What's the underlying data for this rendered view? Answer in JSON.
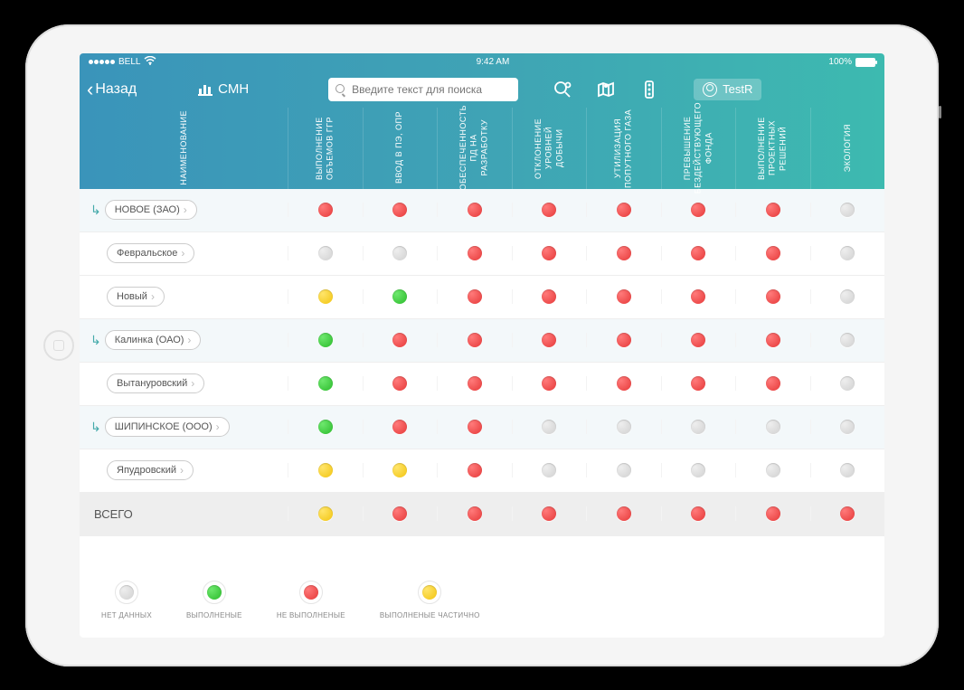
{
  "status_bar": {
    "carrier": "BELL",
    "time": "9:42 AM",
    "battery": "100%"
  },
  "nav": {
    "back_label": "Назад",
    "title": "СМН",
    "search_placeholder": "Введите текст для поиска",
    "user": "TestR"
  },
  "columns": {
    "name": "НАИМЕНОВАНИЕ",
    "c1": "ВЫПОЛНЕНИЕ ОБЪЕМОВ ГГР",
    "c2": "ВВОД В ПЭ, ОПР",
    "c3": "ОБЕСПЕЧЕННОСТЬ ПД НА РАЗРАБОТКУ",
    "c4": "ОТКЛОНЕНИЕ УРОВНЕЙ ДОБЫЧИ",
    "c5": "УТИЛИЗАЦИЯ ПОПУТНОГО ГАЗА",
    "c6": "ПРЕВЫШЕНИЕ БЕЗДЕЙСТВУЮЩЕГО ФОНДА",
    "c7": "ВЫПОЛНЕНИЕ ПРОЕКТНЫХ РЕШЕНИЙ",
    "c8": "ЭКОЛОГИЯ"
  },
  "rows": [
    {
      "type": "parent",
      "name": "НОВОЕ (ЗАО)",
      "status": [
        "red",
        "red",
        "red",
        "red",
        "red",
        "red",
        "red",
        "gray"
      ]
    },
    {
      "type": "child",
      "name": "Февральское",
      "status": [
        "gray",
        "gray",
        "red",
        "red",
        "red",
        "red",
        "red",
        "gray"
      ]
    },
    {
      "type": "child",
      "name": "Новый",
      "status": [
        "yellow",
        "green",
        "red",
        "red",
        "red",
        "red",
        "red",
        "gray"
      ]
    },
    {
      "type": "parent",
      "name": "Калинка (ОАО)",
      "status": [
        "green",
        "red",
        "red",
        "red",
        "red",
        "red",
        "red",
        "gray"
      ]
    },
    {
      "type": "child",
      "name": "Вытануровский",
      "status": [
        "green",
        "red",
        "red",
        "red",
        "red",
        "red",
        "red",
        "gray"
      ]
    },
    {
      "type": "parent",
      "name": "ШИПИНСКОЕ (ООО)",
      "status": [
        "green",
        "red",
        "red",
        "gray",
        "gray",
        "gray",
        "gray",
        "gray"
      ]
    },
    {
      "type": "child",
      "name": "Япудровский",
      "status": [
        "yellow",
        "yellow",
        "red",
        "gray",
        "gray",
        "gray",
        "gray",
        "gray"
      ]
    },
    {
      "type": "total",
      "name": "ВСЕГО",
      "status": [
        "yellow",
        "red",
        "red",
        "red",
        "red",
        "red",
        "red",
        "red"
      ]
    }
  ],
  "legend": {
    "none": "НЕТ ДАННЫХ",
    "done": "ВЫПОЛНЕНЫЕ",
    "notdone": "НЕ ВЫПОЛНЕНЫЕ",
    "partial": "ВЫПОЛНЕНЫЕ ЧАСТИЧНО"
  }
}
